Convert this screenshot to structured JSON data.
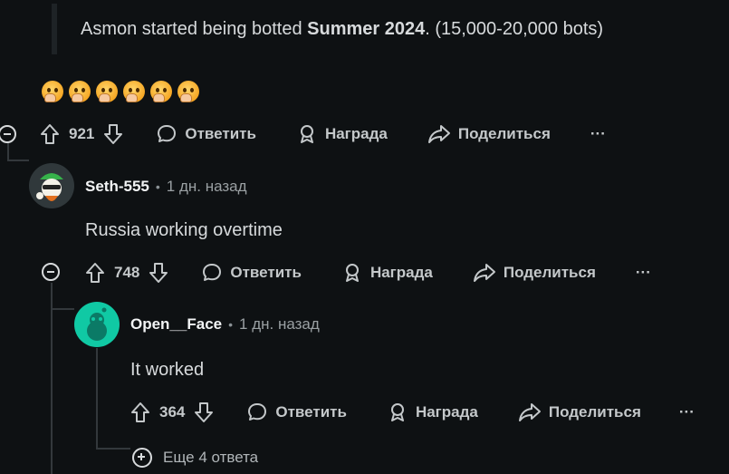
{
  "quote": {
    "prefix": "Asmon started being botted ",
    "bold": "Summer 2024",
    "suffix": ". (15,000-20,000 bots)"
  },
  "emojis": [
    "😱",
    "😱",
    "😱",
    "😱",
    "😱",
    "😱"
  ],
  "labels": {
    "reply": "Ответить",
    "award": "Награда",
    "share": "Поделиться",
    "more": "···"
  },
  "comments": [
    {
      "score": "921"
    },
    {
      "user": "Seth-555",
      "separator": "•",
      "time": "1 дн. назад",
      "text": "Russia working overtime",
      "score": "748"
    },
    {
      "user": "Open__Face",
      "separator": "•",
      "time": "1 дн. назад",
      "text": "It worked",
      "score": "364"
    }
  ],
  "more_replies": "Еще 4 ответа",
  "colors": {
    "background": "#0e1113",
    "text": "#d7dadc",
    "muted": "#9aa0a3",
    "avatar_teal": "#10c9a4"
  }
}
